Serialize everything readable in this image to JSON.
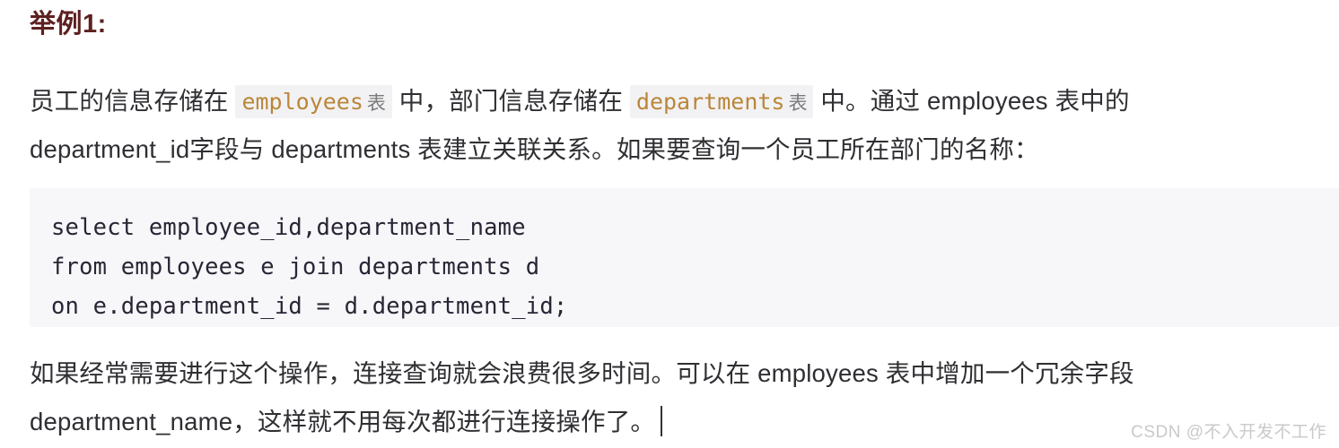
{
  "page": {
    "background_color": "#ffffff",
    "text_color": "#2f2f33"
  },
  "heading": {
    "text": "举例1:",
    "color": "#5e2020"
  },
  "intro_paragraph": {
    "line1_part1": "员工的信息存储在 ",
    "code1": "employees",
    "code1_suffix": "表",
    "line1_part2": " 中，部门信息存储在 ",
    "code2": "departments",
    "code2_suffix": "表",
    "line1_part3": " 中。通过 employees 表中的",
    "line2": "department_id字段与 departments 表建立关联关系。如果要查询一个员工所在部门的名称："
  },
  "code_block": {
    "background_color": "#f7f7f9",
    "text_color": "#2a2535",
    "lines": [
      "select employee_id,department_name",
      "from employees e join departments d",
      "on e.department_id = d.department_id;"
    ],
    "line1": "select employee_id,department_name",
    "line2": "from employees e join departments d",
    "line3": "on e.department_id = d.department_id;"
  },
  "closing_paragraph": {
    "line1": "如果经常需要进行这个操作，连接查询就会浪费很多时间。可以在 employees 表中增加一个冗余字段",
    "line2": "department_name，这样就不用每次都进行连接操作了。"
  },
  "watermark": {
    "text": "CSDN @不入开发不工作",
    "color": "#c9c9cc"
  },
  "inline_code_style": {
    "color": "#bb8639",
    "background": "#f2f2f4"
  }
}
